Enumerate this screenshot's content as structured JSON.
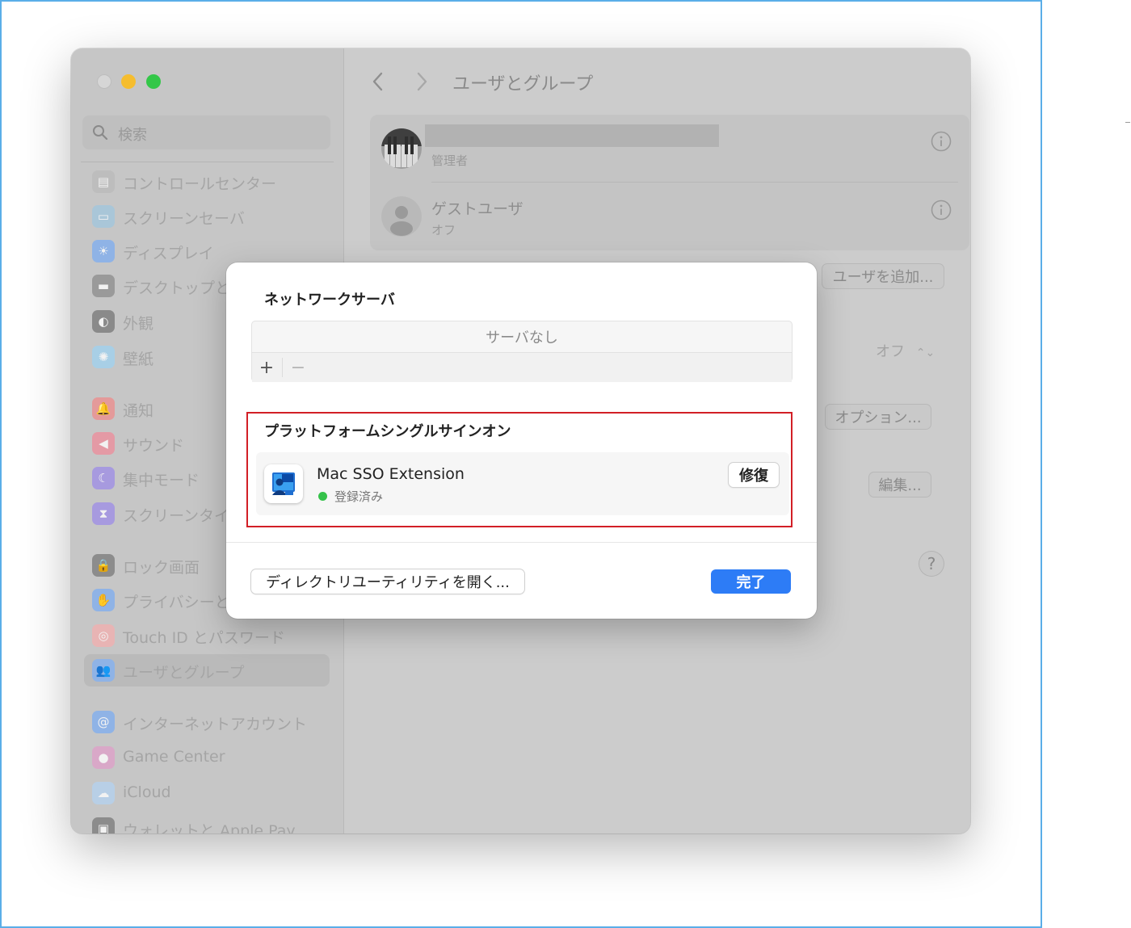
{
  "sidebar": {
    "search_placeholder": "検索",
    "items": [
      {
        "label": "コントロールセンター",
        "icon": "control-center-icon",
        "color": "#bdbdbd"
      },
      {
        "label": "スクリーンセーバ",
        "icon": "screensaver-icon",
        "color": "#a9c6d8"
      },
      {
        "label": "ディスプレイ",
        "icon": "display-icon",
        "color": "#8fb3e6"
      },
      {
        "label": "デスクトップと",
        "icon": "desktop-icon",
        "color": "#9a9a9a"
      },
      {
        "label": "外観",
        "icon": "appearance-icon",
        "color": "#8a8a8a"
      },
      {
        "label": "壁紙",
        "icon": "wallpaper-icon",
        "color": "#a8cfe6"
      },
      {
        "label": "通知",
        "icon": "notifications-icon",
        "color": "#e49a9a"
      },
      {
        "label": "サウンド",
        "icon": "sound-icon",
        "color": "#e49aa5"
      },
      {
        "label": "集中モード",
        "icon": "focus-icon",
        "color": "#a79adf"
      },
      {
        "label": "スクリーンタイ",
        "icon": "screentime-icon",
        "color": "#a79adf"
      },
      {
        "label": "ロック画面",
        "icon": "lock-icon",
        "color": "#8c8c8c"
      },
      {
        "label": "プライバシーと",
        "icon": "privacy-icon",
        "color": "#8fb3e6"
      },
      {
        "label": "Touch ID とパスワード",
        "icon": "fingerprint-icon",
        "color": "#e8b4b4"
      },
      {
        "label": "ユーザとグループ",
        "icon": "users-icon",
        "color": "#8fb3e6"
      },
      {
        "label": "インターネットアカウント",
        "icon": "internet-accounts-icon",
        "color": "#8fb3e6"
      },
      {
        "label": "Game Center",
        "icon": "game-center-icon",
        "color": "#d9a8c8"
      },
      {
        "label": "iCloud",
        "icon": "icloud-icon",
        "color": "#b8cfe6"
      },
      {
        "label": "ウォレットと Apple Pay",
        "icon": "wallet-icon",
        "color": "#8c8c8c"
      }
    ]
  },
  "content": {
    "title": "ユーザとグループ",
    "users": [
      {
        "name": "",
        "role": "管理者"
      },
      {
        "name": "ゲストユーザ",
        "role": "オフ"
      }
    ],
    "add_user_label": "ユーザを追加...",
    "autologin_value": "オフ",
    "options_label": "オプション...",
    "edit_label": "編集...",
    "help_label": "?"
  },
  "dialog": {
    "network_title": "ネットワークサーバ",
    "no_server": "サーバなし",
    "plus": "+",
    "minus": "−",
    "sso_title": "プラットフォームシングルサインオン",
    "sso_name": "Mac SSO Extension",
    "sso_status": "登録済み",
    "repair_label": "修復",
    "directory_label": "ディレクトリユーティリティを開く...",
    "done_label": "完了"
  },
  "colors": {
    "accent": "#2d7cf6",
    "highlight": "#d21f26",
    "status_ok": "#35c24a"
  }
}
